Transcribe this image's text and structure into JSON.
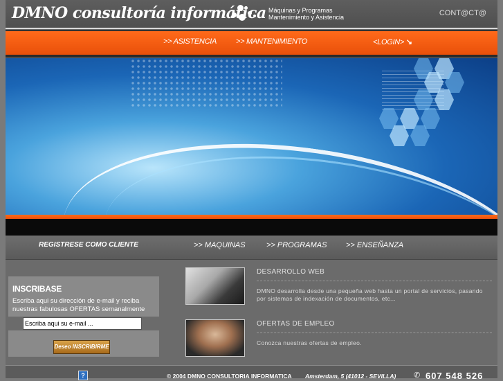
{
  "header": {
    "logo": "DMNO consultoría informática",
    "tagline_line1": "Máquinas y Programas",
    "tagline_line2": "Mantenimiento y Asistencia",
    "contact": "CONT@CT@"
  },
  "nav": {
    "asistencia": ">> ASISTENCIA",
    "mantenimiento": ">> MANTENIMIENTO",
    "login": "<LOGIN>",
    "login_arrow": "↘"
  },
  "subnav": {
    "register": "REGISTRESE COMO CLIENTE",
    "maquinas": ">> MAQUINAS",
    "programas": ">> PROGRAMAS",
    "ensenanza": ">> ENSEÑANZA"
  },
  "subscribe": {
    "title": "INSCRIBASE",
    "description": "Escriba aqui su dirección de e-mail y reciba nuestras fabulosas OFERTAS semanalmente",
    "input_value": "Escriba aqui su e-mail ...",
    "button": "Deseo INSCRIBIRME"
  },
  "sections": [
    {
      "title": "DESARROLLO WEB",
      "description": "DMNO desarrolla desde una pequeña web hasta un portal de servicios, pasando por sistemas de indexación de documentos, etc..."
    },
    {
      "title": "OFERTAS DE EMPLEO",
      "description": "Conozca nuestras ofertas de empleo."
    }
  ],
  "footer": {
    "help_icon": "?",
    "copyright": "© 2004 DMNO CONSULTORIA INFORMATICA",
    "address": "Amsterdam, 5 (41012 - SEVILLA)",
    "phone_icon": "✆",
    "phone": "607 548 526"
  },
  "colors": {
    "accent": "#f25d12",
    "background": "#6b6b6b",
    "hero": "#1b66b6"
  },
  "icons": [
    "help-icon",
    "phone-icon",
    "arrow-down-right-icon"
  ]
}
